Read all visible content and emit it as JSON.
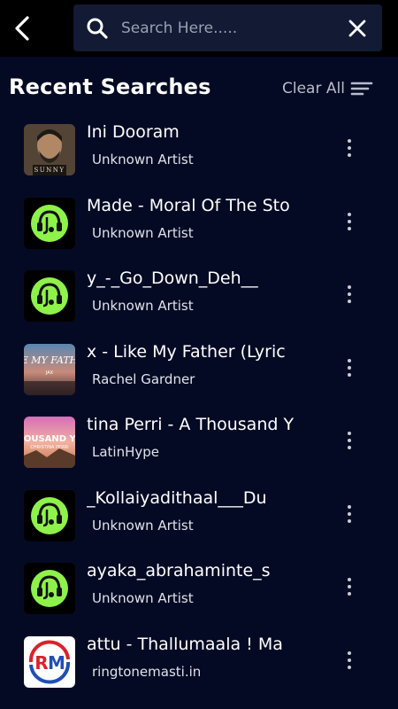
{
  "search": {
    "placeholder": "Search Here....."
  },
  "section": {
    "title": "Recent Searches",
    "clear_all_label": "Clear All"
  },
  "items": [
    {
      "title": "Ini Dooram",
      "artist": "Unknown Artist",
      "thumb": "sunny-poster"
    },
    {
      "title": "Made - Moral Of The Sto",
      "artist": "Unknown Artist",
      "thumb": "green-headphones-logo"
    },
    {
      "title": "y_-_Go_Down_Deh__",
      "artist": "Unknown Artist",
      "thumb": "green-headphones-logo"
    },
    {
      "title": "x  - Like My Father (Lyric",
      "artist": "Rachel Gardner",
      "thumb": "like-my-father-art"
    },
    {
      "title": "tina Perri - A Thousand Y",
      "artist": "LatinHype",
      "thumb": "thousand-years-art"
    },
    {
      "title": "_Kollaiyadithaal___Du",
      "artist": "Unknown Artist",
      "thumb": "green-headphones-logo"
    },
    {
      "title": "ayaka_abrahaminte_s",
      "artist": "Unknown Artist",
      "thumb": "green-headphones-logo"
    },
    {
      "title": "attu - Thallumaala ! Ma",
      "artist": "ringtonemasti.in",
      "thumb": "rm-logo"
    }
  ],
  "colors": {
    "background": "#050a24",
    "topbar": "#000000",
    "search_box": "#121a34",
    "accent_green": "#8ef24a"
  }
}
